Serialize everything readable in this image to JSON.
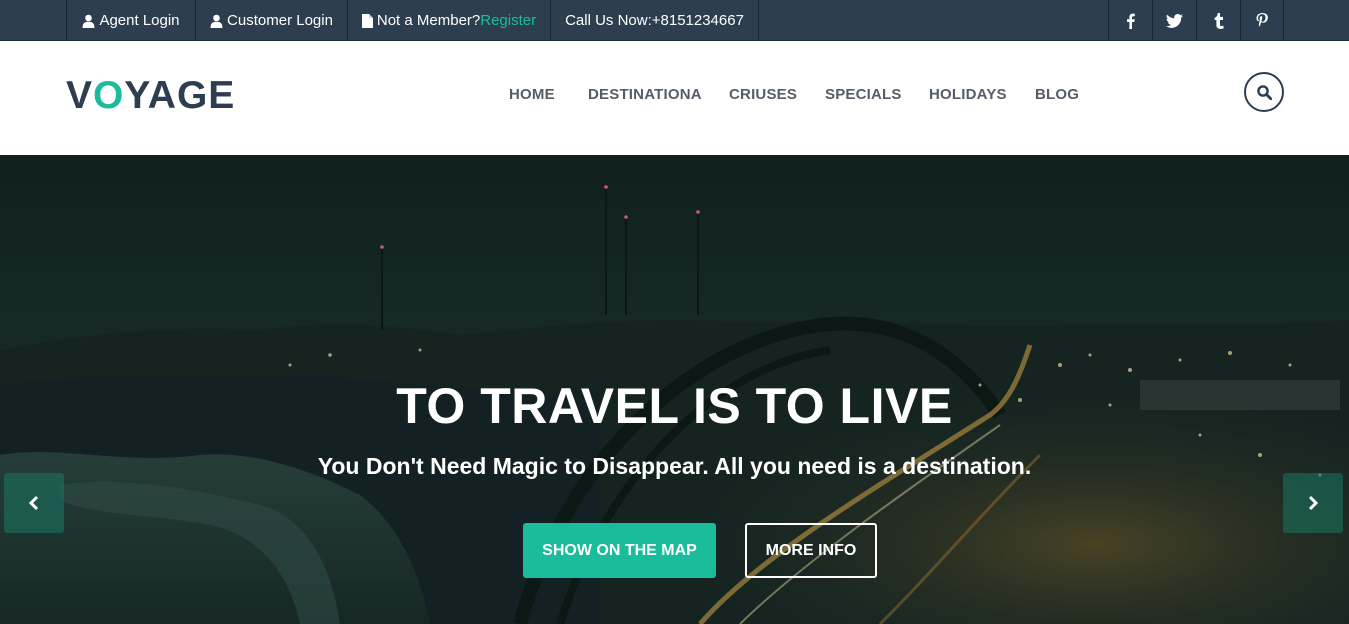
{
  "topbar": {
    "agent_login": "Agent Login",
    "customer_login": "Customer Login",
    "not_member": "Not a Member?",
    "register": "Register",
    "call_us": "Call Us Now:+8151234667",
    "social": [
      "facebook-icon",
      "twitter-icon",
      "tumblr-icon",
      "pinterest-icon"
    ]
  },
  "header": {
    "logo_part1": "V",
    "logo_accent": "O",
    "logo_part2": "YAGE",
    "nav": [
      "HOME",
      "DESTINATIONA",
      "CRIUSES",
      "SPECIALS",
      "HOLIDAYS",
      "BLOG"
    ]
  },
  "hero": {
    "title": "TO TRAVEL IS TO LIVE",
    "subtitle": "You Don't Need Magic to Disappear. All you need is a destination.",
    "primary_button": "SHOW ON THE MAP",
    "secondary_button": "MORE INFO"
  },
  "colors": {
    "accent": "#1abc9c",
    "topbar_bg": "#2c3e50",
    "logo_dark": "#2c3e50"
  }
}
